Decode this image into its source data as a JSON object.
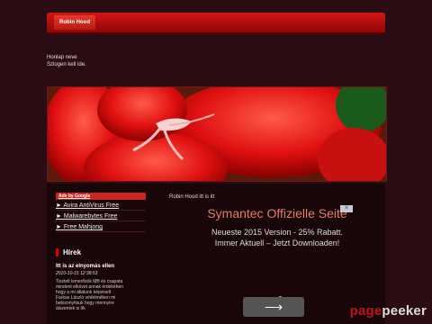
{
  "header": {
    "tab_label": "Robin Hood"
  },
  "site": {
    "name": "Honlap neve",
    "slogan": "Szlogen kell ide."
  },
  "sidebar": {
    "ads_by_label": "Ads by Google",
    "ads": [
      "► Avira AntiVirus Free",
      "► Malwarebytes Free",
      "► Free Mahjong"
    ],
    "news_heading": "Hírek",
    "post": {
      "title": "Itt is az elnyomás ellen",
      "date": "2010-10-15 12:38:53",
      "lines": [
        "Tisztelt ismerősök MB és csapata",
        "mindent elkövet annak érdekében",
        "hogy a mi általunk képviselt",
        "Farkas László védelmében mi",
        "bebizonyítsuk hogy mennyire",
        "álszentek is ők"
      ]
    }
  },
  "main": {
    "intro_text": "Robin Hood itt is itt",
    "ad": {
      "title": "Symantec Offizielle Seite",
      "text": "Neueste 2015 Version - 25% Rabatt. Immer Aktuell – Jetzt Downloaden!",
      "close_glyph": "✕",
      "next_glyph": "⟶"
    }
  },
  "watermark": {
    "part1": "page",
    "part2": "peeker"
  },
  "colors": {
    "accent": "#d41414",
    "ad_title": "#e87a6a",
    "dot_active": "#e05a5a",
    "dot_inactive": "#aaaaaa"
  }
}
